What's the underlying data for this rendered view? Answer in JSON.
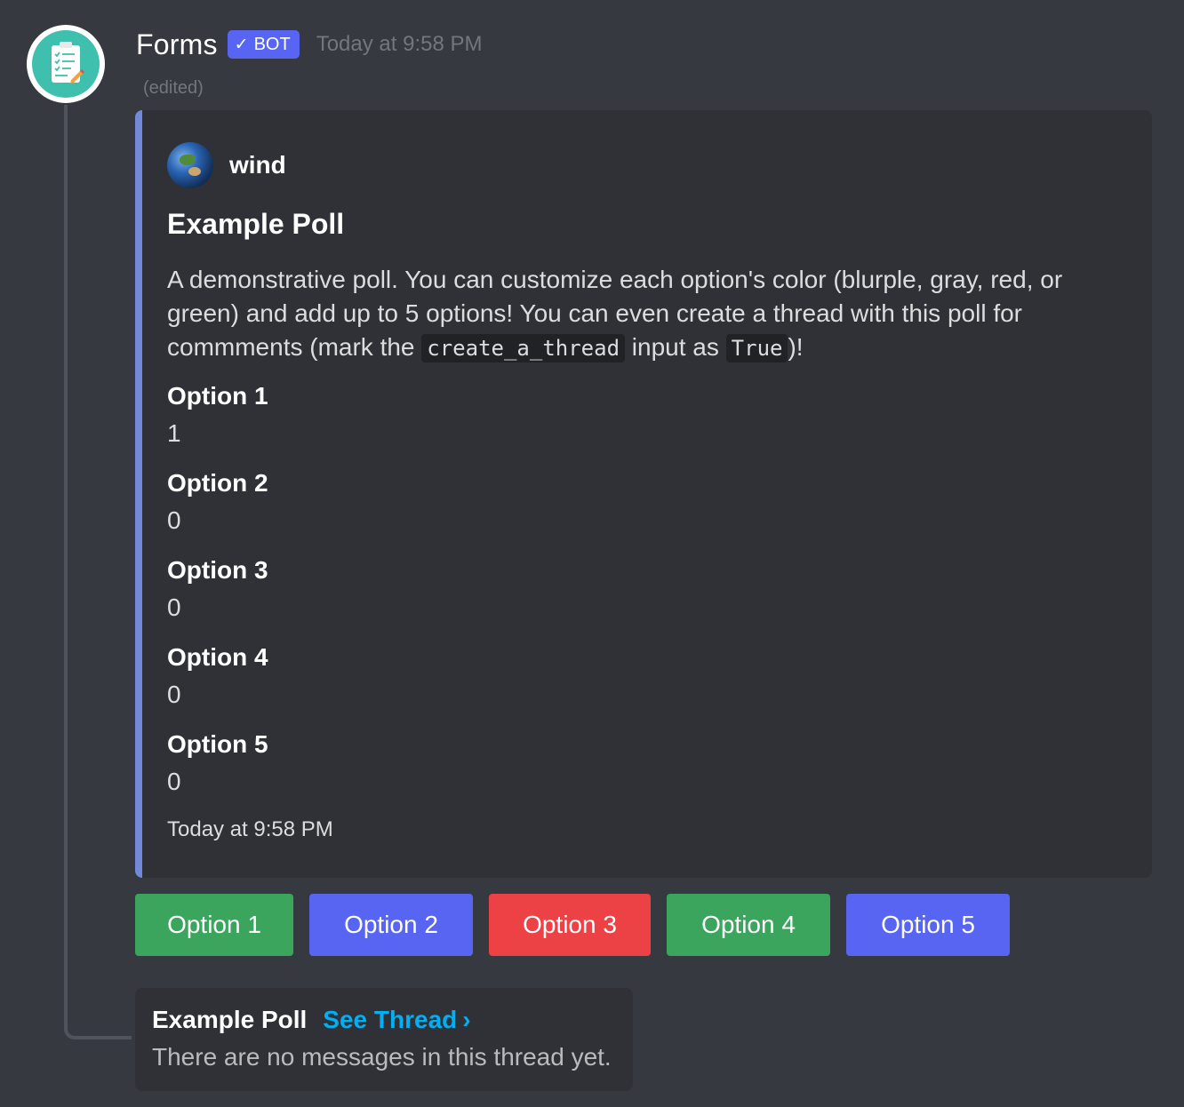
{
  "message": {
    "username": "Forms",
    "bot_tag": "BOT",
    "timestamp": "Today at 9:58 PM",
    "edited": "(edited)",
    "avatar_icon": "form-checklist-icon"
  },
  "embed": {
    "accent_color": "#7289da",
    "author": "wind",
    "author_icon": "earth-icon",
    "title": "Example Poll",
    "description": {
      "part1": "A demonstrative poll. You can customize each option's color (blurple, gray, red, or green) and add up to 5 options! You can even create a thread with this poll for commments (mark the ",
      "code1": "create_a_thread",
      "part2": " input as ",
      "code2": "True",
      "part3": ")!"
    },
    "fields": [
      {
        "name": "Option 1",
        "value": "1"
      },
      {
        "name": "Option 2",
        "value": "0"
      },
      {
        "name": "Option 3",
        "value": "0"
      },
      {
        "name": "Option 4",
        "value": "0"
      },
      {
        "name": "Option 5",
        "value": "0"
      }
    ],
    "footer": "Today at 9:58 PM"
  },
  "buttons": [
    {
      "label": "Option 1",
      "color": "#3ba55d"
    },
    {
      "label": "Option 2",
      "color": "#5865f2"
    },
    {
      "label": "Option 3",
      "color": "#ed4245"
    },
    {
      "label": "Option 4",
      "color": "#3ba55d"
    },
    {
      "label": "Option 5",
      "color": "#5865f2"
    }
  ],
  "thread": {
    "name": "Example Poll",
    "link": "See Thread",
    "chevron": "›",
    "empty_text": "There are no messages in this thread yet."
  }
}
